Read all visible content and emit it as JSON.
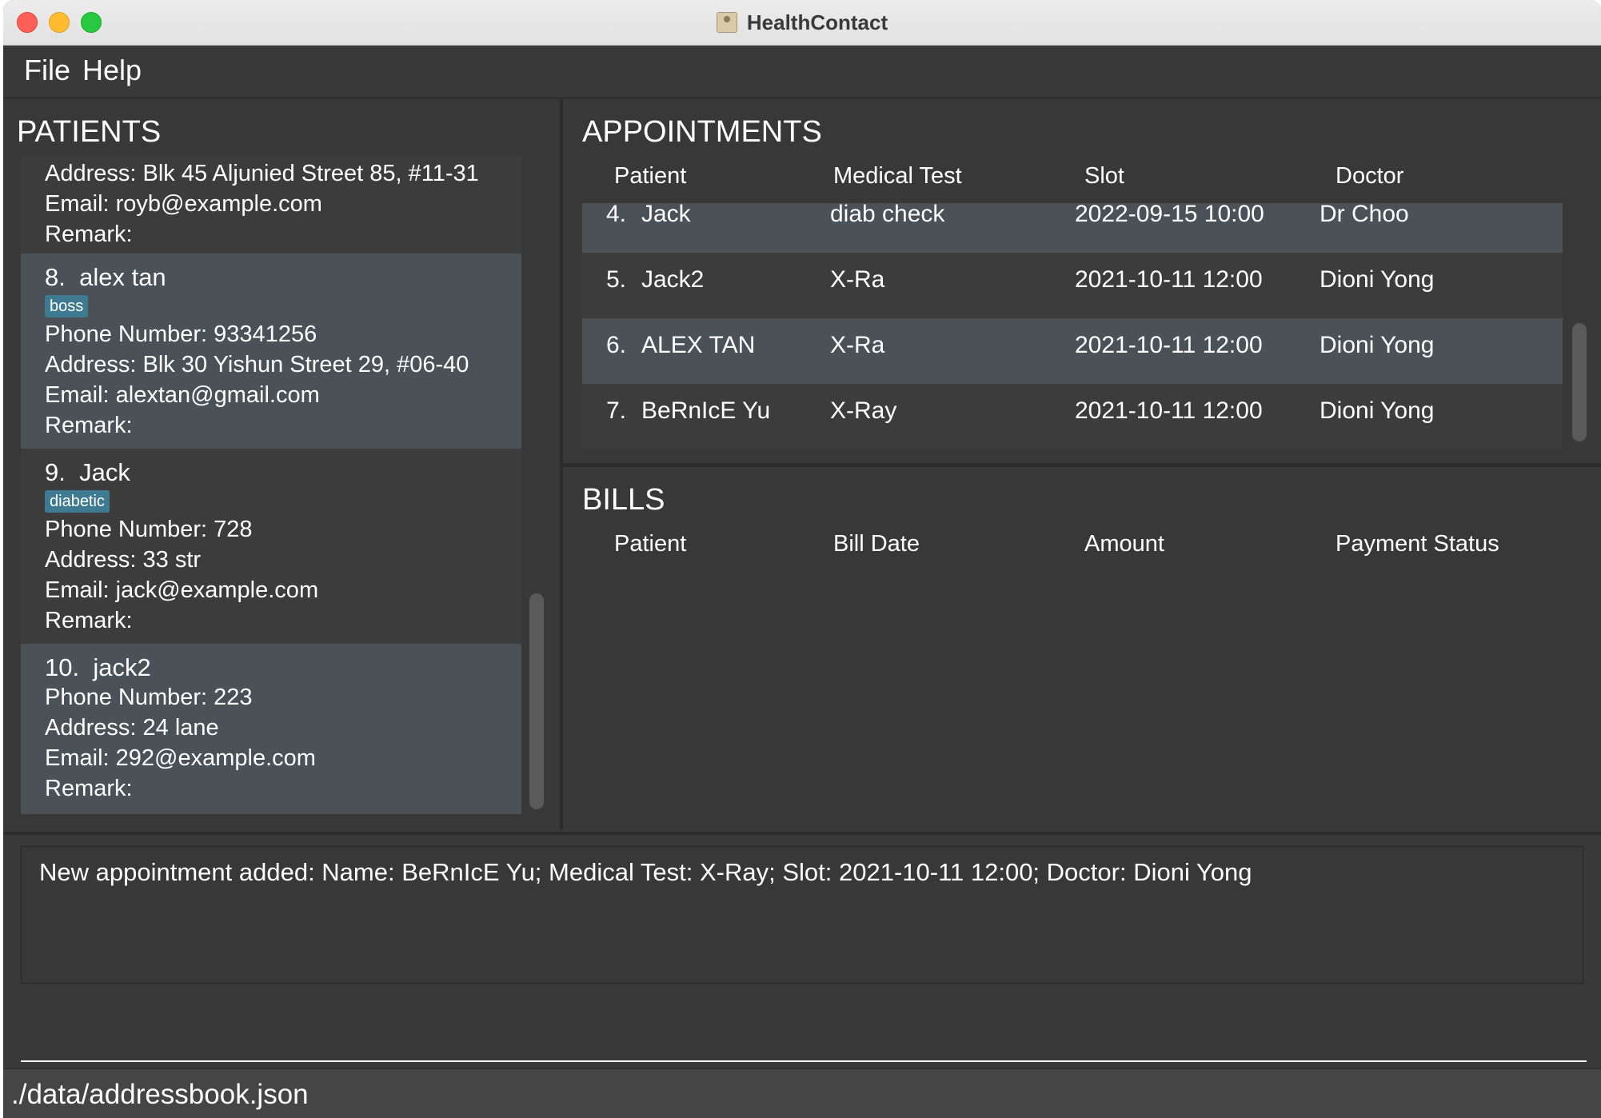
{
  "window": {
    "title": "HealthContact"
  },
  "menu": {
    "file": "File",
    "help": "Help"
  },
  "patients": {
    "title": "PATIENTS",
    "partial_card": {
      "address": "Address: Blk 45 Aljunied Street 85, #11-31",
      "email": "Email: royb@example.com",
      "remark": "Remark:"
    },
    "cards": [
      {
        "index": "8.",
        "name": "alex tan",
        "tag": "boss",
        "phone": "Phone Number: 93341256",
        "address": "Address: Blk 30 Yishun Street 29, #06-40",
        "email": "Email: alextan@gmail.com",
        "remark": "Remark:"
      },
      {
        "index": "9.",
        "name": "Jack",
        "tag": "diabetic",
        "phone": "Phone Number: 728",
        "address": "Address: 33 str",
        "email": "Email: jack@example.com",
        "remark": "Remark:"
      },
      {
        "index": "10.",
        "name": "jack2",
        "phone": "Phone Number: 223",
        "address": "Address: 24 lane",
        "email": "Email: 292@example.com",
        "remark": "Remark:"
      }
    ]
  },
  "appointments": {
    "title": "APPOINTMENTS",
    "headers": {
      "patient": "Patient",
      "test": "Medical Test",
      "slot": "Slot",
      "doctor": "Doctor"
    },
    "rows": [
      {
        "index": "4.",
        "patient": "Jack",
        "test": "diab check",
        "slot": "2022-09-15 10:00",
        "doctor": "Dr Choo"
      },
      {
        "index": "5.",
        "patient": "Jack2",
        "test": "X-Ra",
        "slot": "2021-10-11 12:00",
        "doctor": "Dioni Yong"
      },
      {
        "index": "6.",
        "patient": "ALEX TAN",
        "test": "X-Ra",
        "slot": "2021-10-11 12:00",
        "doctor": "Dioni Yong"
      },
      {
        "index": "7.",
        "patient": "BeRnIcE Yu",
        "test": "X-Ray",
        "slot": "2021-10-11 12:00",
        "doctor": "Dioni Yong"
      }
    ]
  },
  "bills": {
    "title": "BILLS",
    "headers": {
      "patient": "Patient",
      "date": "Bill Date",
      "amount": "Amount",
      "status": "Payment Status"
    }
  },
  "result": {
    "text": "New appointment added: Name: BeRnIcE Yu; Medical Test: X-Ray; Slot: 2021-10-11 12:00; Doctor: Dioni Yong"
  },
  "command": {
    "value": ""
  },
  "status": {
    "path": "./data/addressbook.json"
  }
}
